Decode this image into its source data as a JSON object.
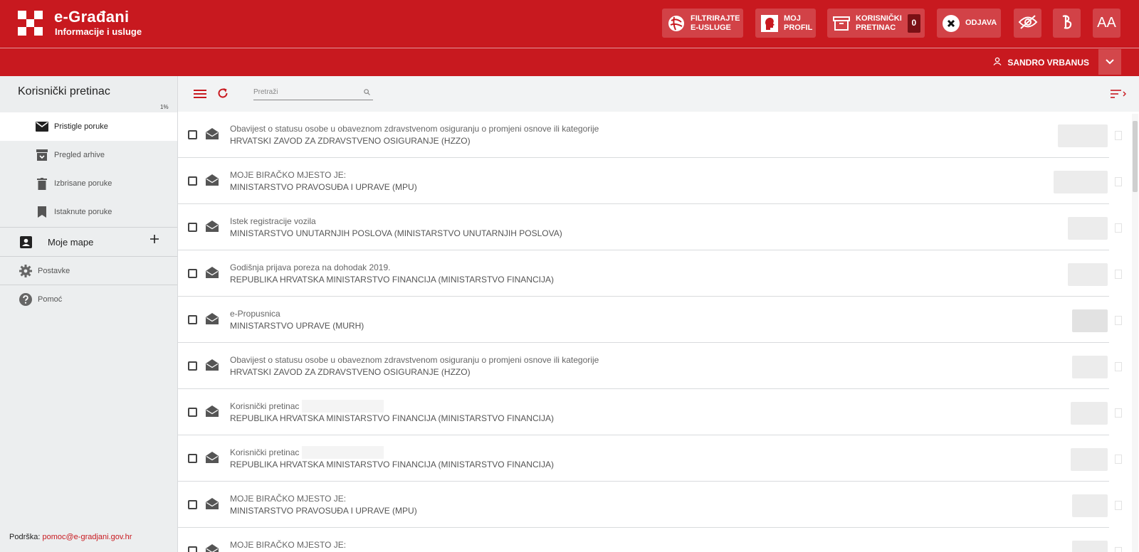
{
  "header": {
    "brand_title": "e-Građani",
    "brand_subtitle": "Informacije i usluge",
    "filter_button": "FILTRIRAJTE\nE-USLUGE",
    "profile_button": "MOJ\nPROFIL",
    "inbox_button": "KORISNIČKI\nPRETINAC",
    "inbox_count": "0",
    "logout_button": "ODJAVA",
    "font_size_button": "AA"
  },
  "user": {
    "name": "SANDRO VRBANUS"
  },
  "sidebar": {
    "title": "Korisnički pretinac",
    "usage_percent": "1%",
    "items": [
      {
        "label": "Pristigle poruke"
      },
      {
        "label": "Pregled arhive"
      },
      {
        "label": "Izbrisane poruke"
      },
      {
        "label": "Istaknute poruke"
      }
    ],
    "folders_label": "Moje mape",
    "settings_label": "Postavke",
    "help_label": "Pomoć",
    "support_label": "Podrška:",
    "support_email": "pomoc@e-gradjani.gov.hr"
  },
  "toolbar": {
    "search_placeholder": "Pretraži"
  },
  "messages": [
    {
      "subject": "Obavijest o statusu osobe u obaveznom zdravstvenom osiguranju o promjeni osnove ili kategorije",
      "sender": "HRVATSKI ZAVOD ZA ZDRAVSTVENO OSIGURANJE (HZZO)"
    },
    {
      "subject": "MOJE BIRAČKO MJESTO JE:",
      "sender": "MINISTARSTVO PRAVOSUĐA I UPRAVE (MPU)"
    },
    {
      "subject": "Istek registracije vozila",
      "sender": "MINISTARSTVO UNUTARNJIH POSLOVA (MINISTARSTVO UNUTARNJIH POSLOVA)"
    },
    {
      "subject": "Godišnja prijava poreza na dohodak 2019.",
      "sender": "REPUBLIKA HRVATSKA MINISTARSTVO FINANCIJA (MINISTARSTVO FINANCIJA)"
    },
    {
      "subject": "e-Propusnica",
      "sender": "MINISTARSTVO UPRAVE (MURH)"
    },
    {
      "subject": "Obavijest o statusu osobe u obaveznom zdravstvenom osiguranju o promjeni osnove ili kategorije",
      "sender": "HRVATSKI ZAVOD ZA ZDRAVSTVENO OSIGURANJE (HZZO)"
    },
    {
      "subject": "Korisnički pretinac",
      "sender": "REPUBLIKA HRVATSKA MINISTARSTVO FINANCIJA (MINISTARSTVO FINANCIJA)"
    },
    {
      "subject": "Korisnički pretinac",
      "sender": "REPUBLIKA HRVATSKA MINISTARSTVO FINANCIJA (MINISTARSTVO FINANCIJA)"
    },
    {
      "subject": "MOJE BIRAČKO MJESTO JE:",
      "sender": "MINISTARSTVO PRAVOSUĐA I UPRAVE (MPU)"
    },
    {
      "subject": "MOJE BIRAČKO MJESTO JE:",
      "sender": ""
    }
  ],
  "colors": {
    "brand_red": "#c8191f",
    "sidebar_bg": "#eceeef"
  }
}
